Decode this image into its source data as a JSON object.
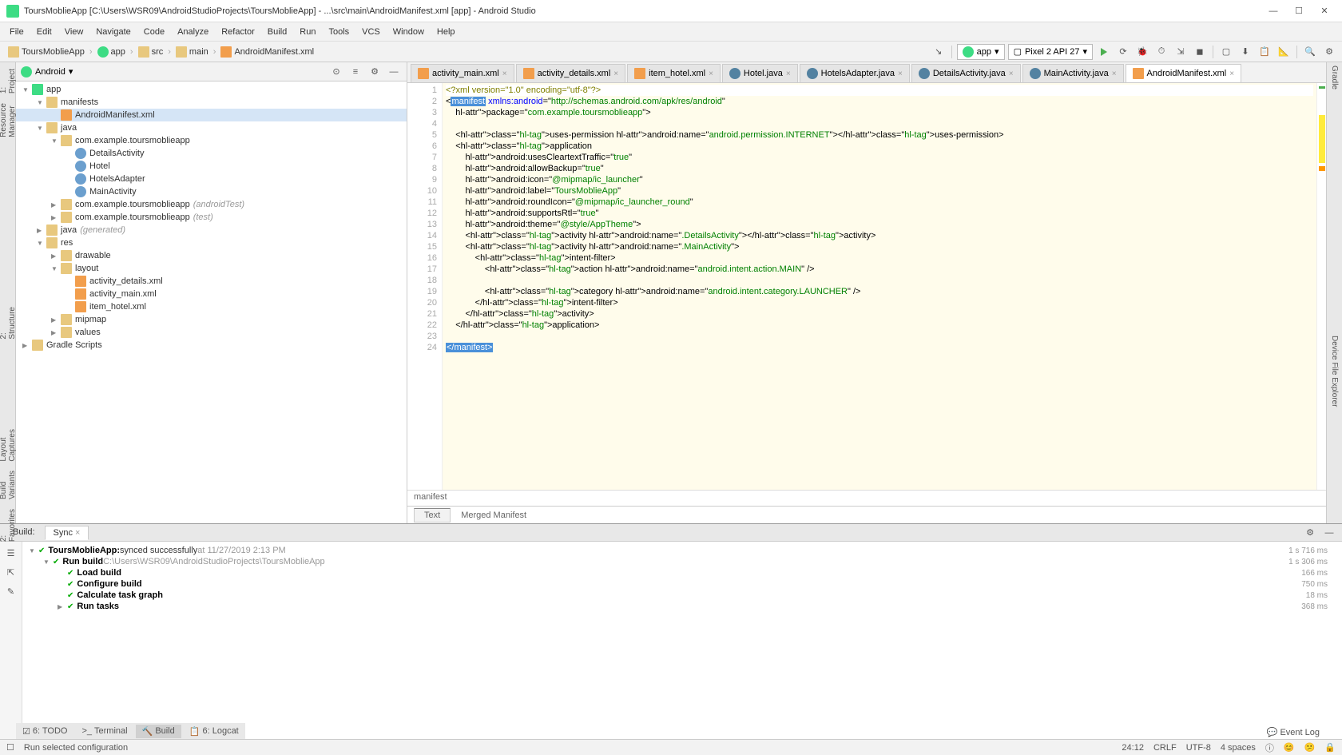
{
  "title": "ToursMoblieApp [C:\\Users\\WSR09\\AndroidStudioProjects\\ToursMoblieApp] - ...\\src\\main\\AndroidManifest.xml [app] - Android Studio",
  "menu": [
    "File",
    "Edit",
    "View",
    "Navigate",
    "Code",
    "Analyze",
    "Refactor",
    "Build",
    "Run",
    "Tools",
    "VCS",
    "Window",
    "Help"
  ],
  "breadcrumb": [
    {
      "label": "ToursMoblieApp",
      "icon": "folder"
    },
    {
      "label": "app",
      "icon": "android"
    },
    {
      "label": "src",
      "icon": "folder"
    },
    {
      "label": "main",
      "icon": "folder"
    },
    {
      "label": "AndroidManifest.xml",
      "icon": "xml"
    }
  ],
  "run_config": "app",
  "device": "Pixel 2 API 27",
  "project_pane": {
    "mode": "Android",
    "tree": [
      {
        "d": 0,
        "t": "▼",
        "i": "android",
        "l": "app"
      },
      {
        "d": 1,
        "t": "▼",
        "i": "folder",
        "l": "manifests"
      },
      {
        "d": 2,
        "t": "",
        "i": "xml",
        "l": "AndroidManifest.xml",
        "sel": true
      },
      {
        "d": 1,
        "t": "▼",
        "i": "folder",
        "l": "java"
      },
      {
        "d": 2,
        "t": "▼",
        "i": "pkg",
        "l": "com.example.toursmoblieapp"
      },
      {
        "d": 3,
        "t": "",
        "i": "class",
        "l": "DetailsActivity"
      },
      {
        "d": 3,
        "t": "",
        "i": "class",
        "l": "Hotel"
      },
      {
        "d": 3,
        "t": "",
        "i": "class",
        "l": "HotelsAdapter"
      },
      {
        "d": 3,
        "t": "",
        "i": "class",
        "l": "MainActivity"
      },
      {
        "d": 2,
        "t": "▶",
        "i": "pkg",
        "l": "com.example.toursmoblieapp",
        "h": "(androidTest)"
      },
      {
        "d": 2,
        "t": "▶",
        "i": "pkg",
        "l": "com.example.toursmoblieapp",
        "h": "(test)"
      },
      {
        "d": 1,
        "t": "▶",
        "i": "folder",
        "l": "java",
        "h": "(generated)"
      },
      {
        "d": 1,
        "t": "▼",
        "i": "folder",
        "l": "res"
      },
      {
        "d": 2,
        "t": "▶",
        "i": "folder",
        "l": "drawable"
      },
      {
        "d": 2,
        "t": "▼",
        "i": "folder",
        "l": "layout"
      },
      {
        "d": 3,
        "t": "",
        "i": "xml",
        "l": "activity_details.xml"
      },
      {
        "d": 3,
        "t": "",
        "i": "xml",
        "l": "activity_main.xml"
      },
      {
        "d": 3,
        "t": "",
        "i": "xml",
        "l": "item_hotel.xml"
      },
      {
        "d": 2,
        "t": "▶",
        "i": "folder",
        "l": "mipmap"
      },
      {
        "d": 2,
        "t": "▶",
        "i": "folder",
        "l": "values"
      },
      {
        "d": 0,
        "t": "▶",
        "i": "gradle",
        "l": "Gradle Scripts"
      }
    ]
  },
  "editor_tabs": [
    {
      "label": "activity_main.xml",
      "icon": "xml"
    },
    {
      "label": "activity_details.xml",
      "icon": "xml"
    },
    {
      "label": "item_hotel.xml",
      "icon": "xml"
    },
    {
      "label": "Hotel.java",
      "icon": "java"
    },
    {
      "label": "HotelsAdapter.java",
      "icon": "java"
    },
    {
      "label": "DetailsActivity.java",
      "icon": "java"
    },
    {
      "label": "MainActivity.java",
      "icon": "java"
    },
    {
      "label": "AndroidManifest.xml",
      "icon": "xml",
      "active": true
    }
  ],
  "code": {
    "lines": [
      {
        "n": 1,
        "c": "<?xml version=\"1.0\" encoding=\"utf-8\"?>",
        "type": "decl"
      },
      {
        "n": 2,
        "c": "<manifest xmlns:android=\"http://schemas.android.com/apk/res/android\"",
        "hl": "manifest"
      },
      {
        "n": 3,
        "c": "    package=\"com.example.toursmoblieapp\">"
      },
      {
        "n": 4,
        "c": ""
      },
      {
        "n": 5,
        "c": "    <uses-permission android:name=\"android.permission.INTERNET\"></uses-permission>"
      },
      {
        "n": 6,
        "c": "    <application"
      },
      {
        "n": 7,
        "c": "        android:usesCleartextTraffic=\"true\""
      },
      {
        "n": 8,
        "c": "        android:allowBackup=\"true\""
      },
      {
        "n": 9,
        "c": "        android:icon=\"@mipmap/ic_launcher\""
      },
      {
        "n": 10,
        "c": "        android:label=\"ToursMoblieApp\""
      },
      {
        "n": 11,
        "c": "        android:roundIcon=\"@mipmap/ic_launcher_round\""
      },
      {
        "n": 12,
        "c": "        android:supportsRtl=\"true\""
      },
      {
        "n": 13,
        "c": "        android:theme=\"@style/AppTheme\">"
      },
      {
        "n": 14,
        "c": "        <activity android:name=\".DetailsActivity\"></activity>"
      },
      {
        "n": 15,
        "c": "        <activity android:name=\".MainActivity\">"
      },
      {
        "n": 16,
        "c": "            <intent-filter>"
      },
      {
        "n": 17,
        "c": "                <action android:name=\"android.intent.action.MAIN\" />"
      },
      {
        "n": 18,
        "c": ""
      },
      {
        "n": 19,
        "c": "                <category android:name=\"android.intent.category.LAUNCHER\" />"
      },
      {
        "n": 20,
        "c": "            </intent-filter>"
      },
      {
        "n": 21,
        "c": "        </activity>"
      },
      {
        "n": 22,
        "c": "    </application>"
      },
      {
        "n": 23,
        "c": ""
      },
      {
        "n": 24,
        "c": "</manifest>",
        "hl": "manifest-close"
      }
    ]
  },
  "breadcrumb_bottom": "manifest",
  "editor_bottom_tabs": [
    "Text",
    "Merged Manifest"
  ],
  "build": {
    "tabs": [
      "Build:",
      "Sync"
    ],
    "items": [
      {
        "d": 0,
        "t": "▼",
        "l": "ToursMoblieApp:",
        "s": "synced successfully",
        "ts": " at 11/27/2019 2:13 PM",
        "time": "1 s 716 ms"
      },
      {
        "d": 1,
        "t": "▼",
        "l": "Run build",
        "p": " C:\\Users\\WSR09\\AndroidStudioProjects\\ToursMoblieApp",
        "time": "1 s 306 ms"
      },
      {
        "d": 2,
        "t": "",
        "l": "Load build",
        "time": "166 ms"
      },
      {
        "d": 2,
        "t": "",
        "l": "Configure build",
        "time": "750 ms"
      },
      {
        "d": 2,
        "t": "",
        "l": "Calculate task graph",
        "time": "18 ms"
      },
      {
        "d": 2,
        "t": "▶",
        "l": "Run tasks",
        "time": "368 ms"
      }
    ]
  },
  "tool_tabs": [
    "TODO",
    "Terminal",
    "Build",
    "Logcat"
  ],
  "event_log": "Event Log",
  "status": {
    "left": "Run selected configuration",
    "pos": "24:12",
    "sep": "CRLF",
    "enc": "UTF-8",
    "indent": "4 spaces"
  }
}
